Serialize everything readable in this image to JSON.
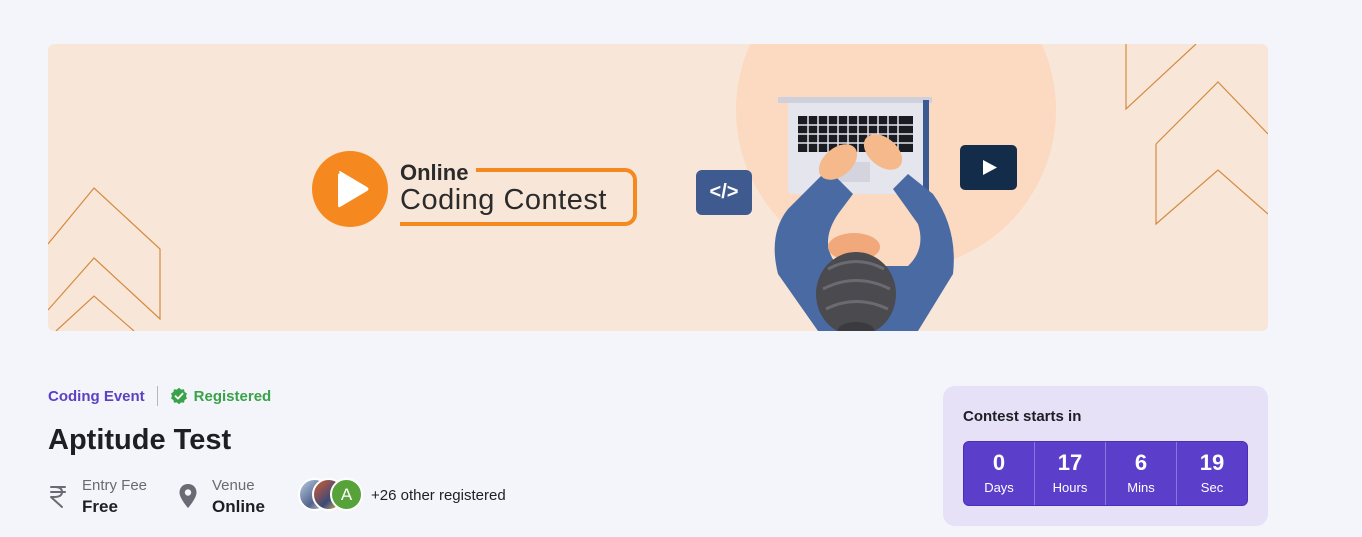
{
  "banner": {
    "logo_line1": "Online",
    "logo_line2": "Coding Contest",
    "code_tag": "</>"
  },
  "event": {
    "category": "Coding Event",
    "status": "Registered",
    "title": "Aptitude Test",
    "entry_fee": {
      "label": "Entry Fee",
      "value": "Free"
    },
    "venue": {
      "label": "Venue",
      "value": "Online"
    },
    "avatar_initial": "A",
    "registered_text": "+26 other registered"
  },
  "countdown": {
    "title": "Contest starts in",
    "cells": [
      {
        "value": "0",
        "unit": "Days"
      },
      {
        "value": "17",
        "unit": "Hours"
      },
      {
        "value": "6",
        "unit": "Mins"
      },
      {
        "value": "19",
        "unit": "Sec"
      }
    ]
  },
  "colors": {
    "accent": "#5b3fcb",
    "banner_bg": "#f8e7d9",
    "brand_orange": "#f5891f",
    "success": "#3aa249"
  }
}
